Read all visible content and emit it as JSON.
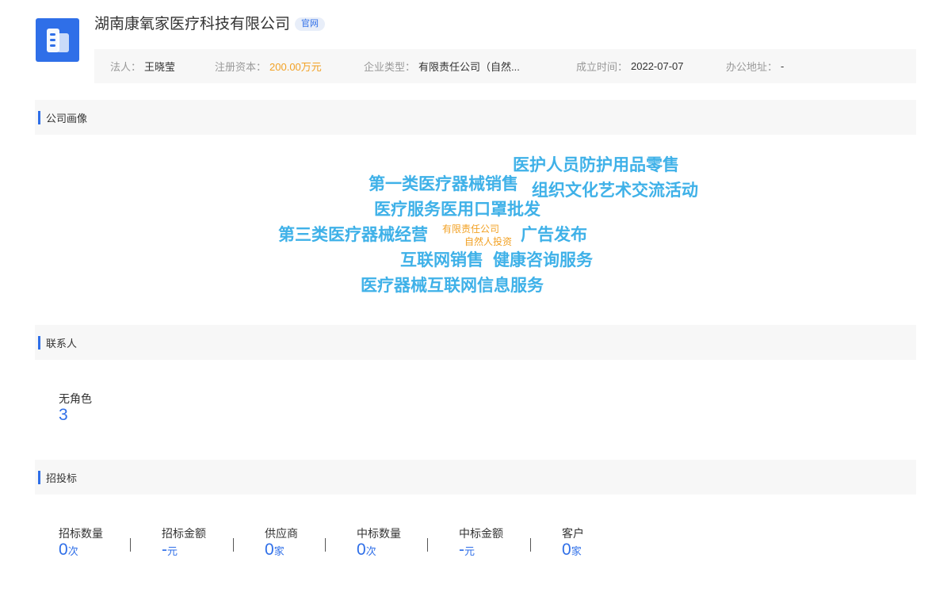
{
  "company": {
    "name": "湖南康氧家医疗科技有限公司",
    "tag": "官网"
  },
  "info": [
    {
      "label": "法人：",
      "value": "王晓莹"
    },
    {
      "label": "注册资本：",
      "value": "200.00万元"
    },
    {
      "label": "企业类型：",
      "value": "有限责任公司（自然..."
    },
    {
      "label": "成立时间：",
      "value": "2022-07-07"
    },
    {
      "label": "办公地址：",
      "value": "-"
    }
  ],
  "sections": {
    "profile": "公司画像",
    "contacts": "联系人",
    "bidding": "招投标"
  },
  "word_cloud": [
    {
      "text": "医护人员防护用品零售"
    },
    {
      "text": "第一类医疗器械销售"
    },
    {
      "text": "组织文化艺术交流活动"
    },
    {
      "text": "医疗服务医用口罩批发"
    },
    {
      "text": "第三类医疗器械经营"
    },
    {
      "text": "有限责任公司"
    },
    {
      "text": "自然人投资"
    },
    {
      "text": "广告发布"
    },
    {
      "text": "互联网销售"
    },
    {
      "text": "健康咨询服务"
    },
    {
      "text": "医疗器械互联网信息服务"
    }
  ],
  "contacts": {
    "label": "无角色",
    "count": "3"
  },
  "bidding": [
    {
      "label": "招标数量",
      "value": "0",
      "unit": "次"
    },
    {
      "label": "招标金额",
      "value": "-",
      "unit": "元"
    },
    {
      "label": "供应商",
      "value": "0",
      "unit": "家"
    },
    {
      "label": "中标数量",
      "value": "0",
      "unit": "次"
    },
    {
      "label": "中标金额",
      "value": "-",
      "unit": "元"
    },
    {
      "label": "客户",
      "value": "0",
      "unit": "家"
    }
  ]
}
